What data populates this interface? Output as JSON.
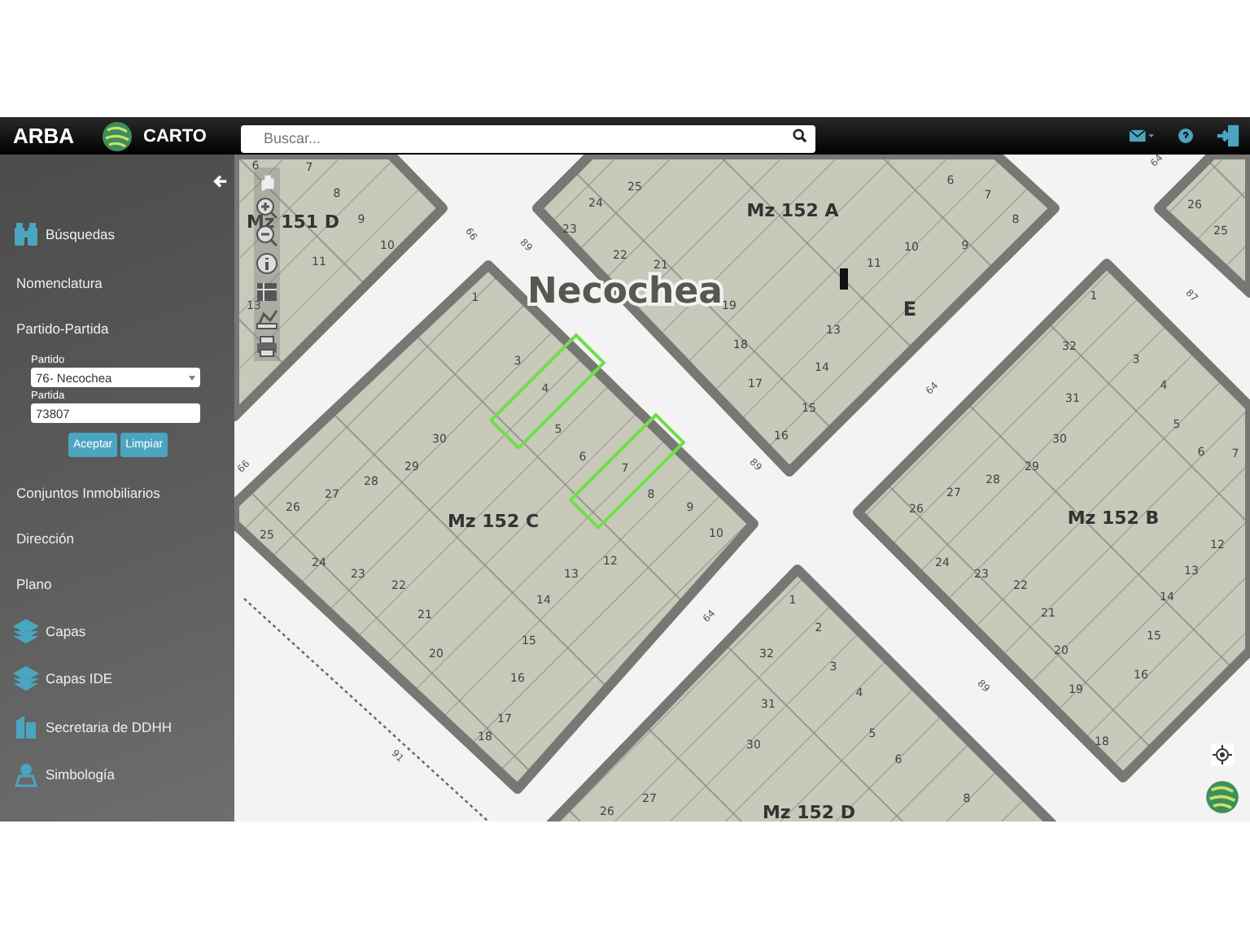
{
  "header": {
    "brand": "ARBA",
    "logo_text": "CARTO",
    "search": {
      "placeholder": "Buscar..."
    }
  },
  "sidebar": {
    "items": [
      {
        "kind": "heading",
        "label": "Búsquedas"
      },
      {
        "kind": "link",
        "label": "Nomenclatura"
      },
      {
        "kind": "link",
        "label": "Partido-Partida"
      },
      {
        "kind": "form",
        "partido_label": "Partido",
        "partido_value": "76- Necochea",
        "partida_label": "Partida",
        "partida_value": "73807",
        "buttons": [
          "Aceptar",
          "Limpiar"
        ]
      },
      {
        "kind": "link",
        "label": "Conjuntos Inmobiliarios"
      },
      {
        "kind": "link",
        "label": "Dirección"
      },
      {
        "kind": "link",
        "label": "Plano"
      },
      {
        "kind": "icon-link",
        "label": "Capas"
      },
      {
        "kind": "icon-link",
        "label": "Capas IDE"
      },
      {
        "kind": "icon-link",
        "label": "Secretaria de DDHH"
      },
      {
        "kind": "icon-link",
        "label": "Simbología"
      }
    ]
  },
  "map": {
    "city_label": "Necochea",
    "blocks": [
      {
        "name": "Mz 151 D",
        "lots": [
          {
            "label": "6",
            "selected": false
          },
          {
            "label": "7",
            "selected": false
          },
          {
            "label": "8",
            "selected": false
          },
          {
            "label": "9",
            "selected": false
          },
          {
            "label": "11",
            "selected": false
          },
          {
            "label": "10",
            "selected": false
          },
          {
            "label": "13",
            "selected": false
          }
        ]
      },
      {
        "name": "Mz 152 C",
        "lots": [
          {
            "label": "1",
            "selected": false
          },
          {
            "label": "3",
            "selected": false
          },
          {
            "label": "4",
            "selected": true
          },
          {
            "label": "5",
            "selected": false
          },
          {
            "label": "6",
            "selected": false
          },
          {
            "label": "7",
            "selected": true
          },
          {
            "label": "8",
            "selected": false
          },
          {
            "label": "9",
            "selected": false
          },
          {
            "label": "10",
            "selected": false
          },
          {
            "label": "12",
            "selected": false
          },
          {
            "label": "13",
            "selected": false
          },
          {
            "label": "14",
            "selected": false
          },
          {
            "label": "15",
            "selected": false
          },
          {
            "label": "16",
            "selected": false
          },
          {
            "label": "17",
            "selected": false
          },
          {
            "label": "18",
            "selected": false
          },
          {
            "label": "20",
            "selected": false
          },
          {
            "label": "21",
            "selected": false
          },
          {
            "label": "22",
            "selected": false
          },
          {
            "label": "23",
            "selected": false
          },
          {
            "label": "24",
            "selected": false
          },
          {
            "label": "25",
            "selected": false
          },
          {
            "label": "26",
            "selected": false
          },
          {
            "label": "27",
            "selected": false
          },
          {
            "label": "28",
            "selected": false
          },
          {
            "label": "29",
            "selected": false
          },
          {
            "label": "30",
            "selected": false
          }
        ]
      },
      {
        "name": "Mz 152 A",
        "lots": [
          {
            "label": "24",
            "selected": false
          },
          {
            "label": "25",
            "selected": false
          },
          {
            "label": "23",
            "selected": false
          },
          {
            "label": "22",
            "selected": false
          },
          {
            "label": "21",
            "selected": false
          },
          {
            "label": "19",
            "selected": false
          },
          {
            "label": "18",
            "selected": false
          },
          {
            "label": "17",
            "selected": false
          },
          {
            "label": "16",
            "selected": false
          },
          {
            "label": "15",
            "selected": false
          },
          {
            "label": "14",
            "selected": false
          },
          {
            "label": "13",
            "selected": false
          },
          {
            "label": "11",
            "selected": false
          },
          {
            "label": "10",
            "selected": false
          },
          {
            "label": "9",
            "selected": false
          },
          {
            "label": "8",
            "selected": false
          },
          {
            "label": "7",
            "selected": false
          },
          {
            "label": "6",
            "selected": false
          },
          {
            "label": "E",
            "selected": false
          }
        ]
      },
      {
        "name": "Mz 152 B",
        "lots": [
          {
            "label": "1",
            "selected": false
          },
          {
            "label": "32",
            "selected": false
          },
          {
            "label": "3",
            "selected": false
          },
          {
            "label": "31",
            "selected": false
          },
          {
            "label": "4",
            "selected": false
          },
          {
            "label": "30",
            "selected": false
          },
          {
            "label": "5",
            "selected": false
          },
          {
            "label": "6",
            "selected": false
          },
          {
            "label": "29",
            "selected": false
          },
          {
            "label": "7",
            "selected": false
          },
          {
            "label": "27",
            "selected": false
          },
          {
            "label": "28",
            "selected": false
          },
          {
            "label": "26",
            "selected": false
          },
          {
            "label": "24",
            "selected": false
          },
          {
            "label": "23",
            "selected": false
          },
          {
            "label": "22",
            "selected": false
          },
          {
            "label": "21",
            "selected": false
          },
          {
            "label": "20",
            "selected": false
          },
          {
            "label": "19",
            "selected": false
          },
          {
            "label": "18",
            "selected": false
          },
          {
            "label": "16",
            "selected": false
          },
          {
            "label": "15",
            "selected": false
          },
          {
            "label": "14",
            "selected": false
          },
          {
            "label": "13",
            "selected": false
          },
          {
            "label": "12",
            "selected": false
          }
        ]
      },
      {
        "name": "Mz 152 D",
        "lots": [
          {
            "label": "1",
            "selected": false
          },
          {
            "label": "2",
            "selected": false
          },
          {
            "label": "3",
            "selected": false
          },
          {
            "label": "32",
            "selected": false
          },
          {
            "label": "31",
            "selected": false
          },
          {
            "label": "4",
            "selected": false
          },
          {
            "label": "5",
            "selected": false
          },
          {
            "label": "30",
            "selected": false
          },
          {
            "label": "6",
            "selected": false
          },
          {
            "label": "8",
            "selected": false
          },
          {
            "label": "27",
            "selected": false
          },
          {
            "label": "26",
            "selected": false
          }
        ]
      },
      {
        "lots": [
          {
            "label": "26",
            "selected": false
          },
          {
            "label": "25",
            "selected": false
          }
        ]
      }
    ],
    "street_labels": [
      "66",
      "89",
      "64",
      "89",
      "87",
      "66",
      "64",
      "89",
      "91",
      "64"
    ]
  }
}
